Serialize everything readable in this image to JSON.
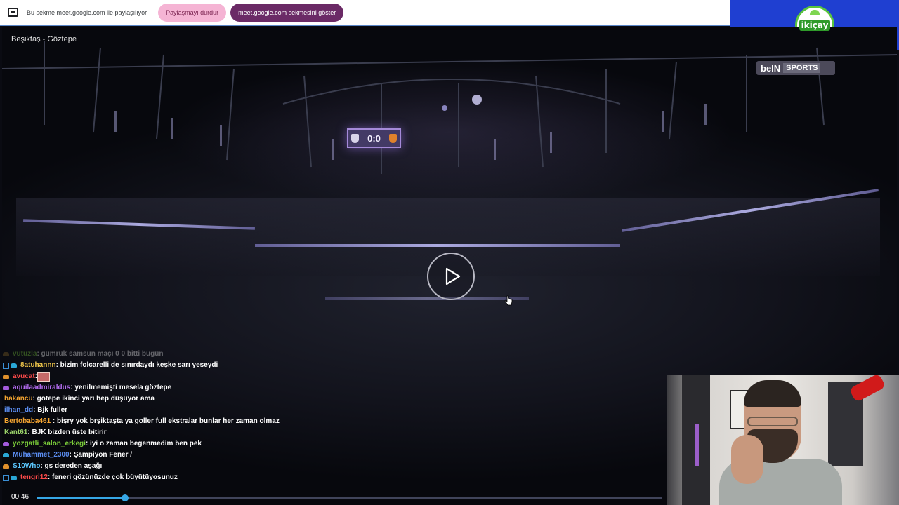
{
  "sharebar": {
    "message": "Bu sekme meet.google.com ile paylaşılıyor",
    "stop_label": "Paylaşmayı durdur",
    "show_label": "meet.google.com sekmesini göster"
  },
  "logo": {
    "text": "ikiçay"
  },
  "video": {
    "title": "Beşiktaş - Göztepe",
    "broadcaster_logo_a": "beIN",
    "broadcaster_logo_b": "SPORTS",
    "score": "0:0",
    "elapsed": "00:46",
    "progress_fraction": 0.14
  },
  "chat": [
    {
      "user": "vutuzla",
      "user_color": "#7ccf3a",
      "badge_color": "#8a6a2a",
      "text": " : gümrük samsun maçı 0 0 bitti bugün",
      "faded": true
    },
    {
      "user": "8atuhannn",
      "user_color": "#f2c84b",
      "badge_color": "#2aa7d6",
      "badge2": true,
      "text": " : bizim folcarelli de sınırdaydı keşke sarı yeseydi"
    },
    {
      "user": "avucat",
      "user_color": "#ff4a4a",
      "badge_color": "#e0902c",
      "text": " : ",
      "emote": true
    },
    {
      "user": "aquilaadmiraldus",
      "user_color": "#b46cf0",
      "badge_color": "#a35bdc",
      "text": " : yenilmemişti mesela göztepe"
    },
    {
      "user": "hakancu",
      "user_color": "#f5a531",
      "badge_color": "",
      "text": " : götepe ikinci yarı hep düşüyor ama"
    },
    {
      "user": "ilhan_dd",
      "user_color": "#5b8df0",
      "badge_color": "",
      "text": " : Bjk fuller"
    },
    {
      "user": "Bertobaba461",
      "user_color": "#f5a531",
      "badge_color": "",
      "text": " : bişry yok brşiktaşta ya goller full ekstralar bunlar her zaman olmaz",
      "wrap": true
    },
    {
      "user": "Kant61",
      "user_color": "#9bd36a",
      "badge_color": "",
      "text": " : BJK bizden üste bitirir"
    },
    {
      "user": "yozgatli_salon_erkegi",
      "user_color": "#7ccf3a",
      "badge_color": "#a35bdc",
      "text": " : iyi o zaman begenmedim ben pek"
    },
    {
      "user": "Muhammet_2300",
      "user_color": "#5b8df0",
      "badge_color": "#2aa7d6",
      "text": " : Şampiyon Fener /"
    },
    {
      "user": "S10Who",
      "user_color": "#5cc8ff",
      "badge_color": "#e0902c",
      "text": " : gs dereden aşağı"
    },
    {
      "user": "tengri12",
      "user_color": "#ff4a4a",
      "badge_color": "#2aa7d6",
      "badge2": true,
      "text": " : feneri gözünüzde çok büyütüyosunuz"
    }
  ],
  "colors": {
    "accent_blue": "#36a7e6",
    "stop_button_bg": "#f5b4d4",
    "show_button_bg": "#6b2a66",
    "logo_bg": "#1f3fd1"
  }
}
